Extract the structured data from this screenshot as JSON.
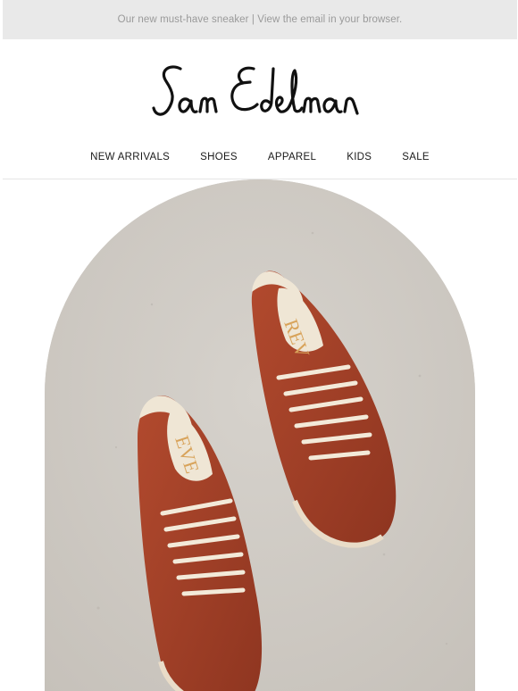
{
  "preheader": {
    "text": "Our new must-have sneaker | View the email in your browser."
  },
  "brand": {
    "logo_text": "Sam Edelman"
  },
  "nav": {
    "items": [
      {
        "label": "NEW ARRIVALS"
      },
      {
        "label": "SHOES"
      },
      {
        "label": "APPAREL"
      },
      {
        "label": "KIDS"
      },
      {
        "label": "SALE"
      }
    ]
  },
  "hero": {
    "image_alt": "Rust orange sneakers on concrete",
    "colors": {
      "background": "#cfcbc5",
      "sneaker": "#a8432a",
      "laces": "#f3ead9",
      "insole": "#efe6d5"
    }
  }
}
